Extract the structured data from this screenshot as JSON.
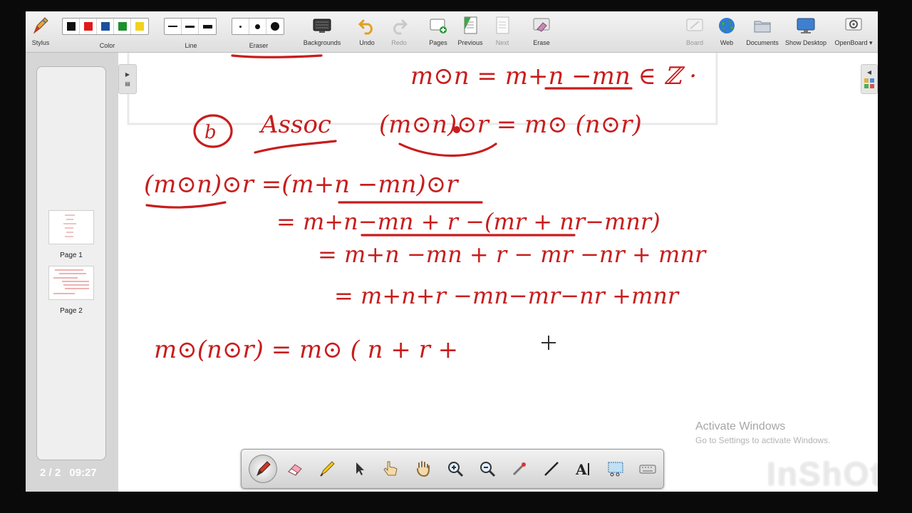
{
  "toolbar": {
    "stylus": "Stylus",
    "color": "Color",
    "line": "Line",
    "eraser": "Eraser",
    "backgrounds": "Backgrounds",
    "undo": "Undo",
    "redo": "Redo",
    "pages": "Pages",
    "previous": "Previous",
    "next": "Next",
    "erase": "Erase",
    "board": "Board",
    "web": "Web",
    "documents": "Documents",
    "show_desktop": "Show Desktop",
    "openboard": "OpenBoard",
    "colors": [
      "#111111",
      "#e01a1a",
      "#1d4f9c",
      "#1f8f2e",
      "#f2d219"
    ]
  },
  "sidebar": {
    "thumbnails": [
      {
        "label": "Page 1"
      },
      {
        "label": "Page 2"
      }
    ],
    "page_counter": "2 / 2",
    "clock": "09:27"
  },
  "board": {
    "ink_color": "#c81d1d",
    "lines": {
      "l0": "m⊙n =  m+n −mn ∈ ℤ ·",
      "l1_circ": "b",
      "l1_label": "Assoc",
      "l1_expr": "(m⊙n)⊙r  =  m⊙ (n⊙r)",
      "l2": "(m⊙n)⊙r =(m+n −mn)⊙r",
      "l3": "=    m+n−mn + r −(mr + nr−mnr)",
      "l4": "=   m+n −mn + r − mr −nr + mnr",
      "l5": "=   m+n+r  −mn−mr−nr +mnr",
      "l6": "m⊙(n⊙r)  =  m⊙ ( n + r +"
    }
  },
  "watermark": {
    "title": "Activate Windows",
    "subtitle": "Go to Settings to activate Windows."
  },
  "brand": "InShOt",
  "palette": [
    "pen-tool",
    "eraser-tool",
    "marker-tool",
    "selector-tool",
    "interact-tool",
    "hand-tool",
    "zoom-in-tool",
    "zoom-out-tool",
    "laser-pointer-tool",
    "line-tool",
    "text-tool",
    "capture-tool",
    "keyboard-tool"
  ]
}
